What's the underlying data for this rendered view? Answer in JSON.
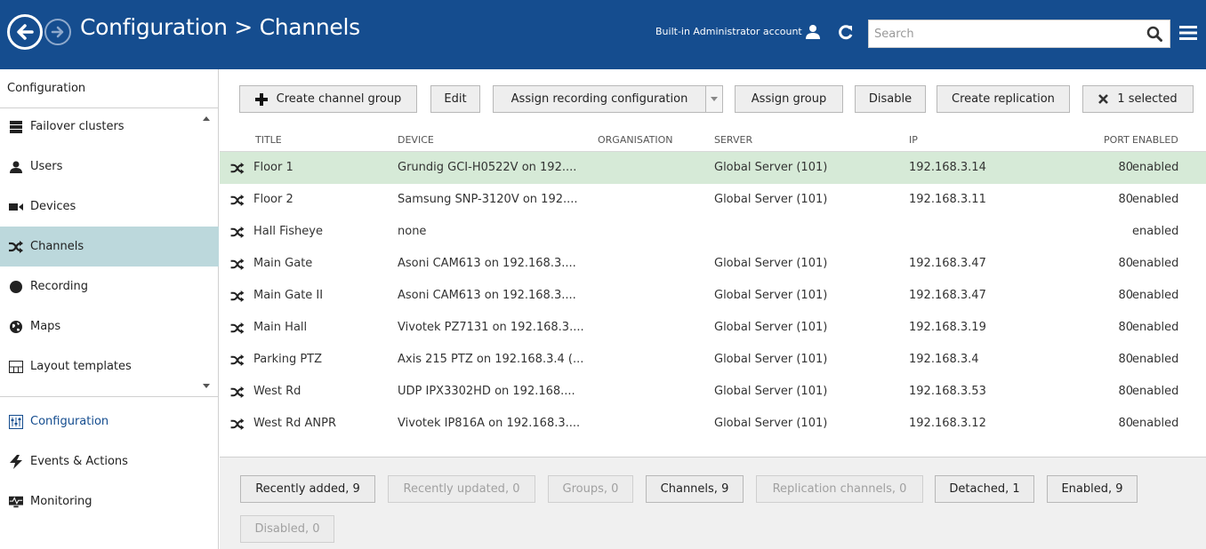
{
  "header": {
    "title": "Configuration > Channels",
    "account_label": "Built-in Administrator account",
    "search_placeholder": "Search"
  },
  "sidebar": {
    "heading": "Configuration",
    "items": [
      {
        "label": "Failover clusters",
        "icon": "server-icon"
      },
      {
        "label": "Users",
        "icon": "user-icon"
      },
      {
        "label": "Devices",
        "icon": "camera-icon"
      },
      {
        "label": "Channels",
        "icon": "shuffle-icon",
        "active": true
      },
      {
        "label": "Recording",
        "icon": "record-icon"
      },
      {
        "label": "Maps",
        "icon": "globe-icon"
      },
      {
        "label": "Layout templates",
        "icon": "layout-icon"
      }
    ],
    "bottom_items": [
      {
        "label": "Configuration",
        "icon": "sliders-icon"
      },
      {
        "label": "Events & Actions",
        "icon": "lightning-icon"
      },
      {
        "label": "Monitoring",
        "icon": "monitor-icon"
      }
    ]
  },
  "toolbar": {
    "create_group": "Create channel group",
    "edit": "Edit",
    "assign_recording": "Assign recording configuration",
    "assign_group": "Assign group",
    "disable": "Disable",
    "create_replication": "Create replication",
    "selected": "1 selected"
  },
  "table": {
    "columns": {
      "title": "TITLE",
      "device": "DEVICE",
      "organisation": "ORGANISATION",
      "server": "SERVER",
      "ip": "IP",
      "port": "PORT",
      "enabled": "ENABLED"
    },
    "rows": [
      {
        "title": "Floor 1",
        "device": "Grundig GCI-H0522V on 192....",
        "server": "Global Server (101)",
        "ip": "192.168.3.14",
        "port": "80",
        "enabled": "enabled"
      },
      {
        "title": "Floor 2",
        "device": "Samsung SNP-3120V on 192....",
        "server": "Global Server (101)",
        "ip": "192.168.3.11",
        "port": "80",
        "enabled": "enabled"
      },
      {
        "title": "Hall Fisheye",
        "device": "none",
        "server": "",
        "ip": "",
        "port": "",
        "enabled": "enabled"
      },
      {
        "title": "Main Gate",
        "device": "Asoni CAM613 on 192.168.3....",
        "server": "Global Server (101)",
        "ip": "192.168.3.47",
        "port": "80",
        "enabled": "enabled"
      },
      {
        "title": "Main Gate II",
        "device": "Asoni CAM613 on 192.168.3....",
        "server": "Global Server (101)",
        "ip": "192.168.3.47",
        "port": "80",
        "enabled": "enabled"
      },
      {
        "title": "Main Hall",
        "device": "Vivotek PZ7131 on 192.168.3....",
        "server": "Global Server (101)",
        "ip": "192.168.3.19",
        "port": "80",
        "enabled": "enabled"
      },
      {
        "title": "Parking PTZ",
        "device": "Axis 215 PTZ on 192.168.3.4 (...",
        "server": "Global Server (101)",
        "ip": "192.168.3.4",
        "port": "80",
        "enabled": "enabled"
      },
      {
        "title": "West Rd",
        "device": "UDP IPX3302HD on 192.168....",
        "server": "Global Server (101)",
        "ip": "192.168.3.53",
        "port": "80",
        "enabled": "enabled"
      },
      {
        "title": "West Rd ANPR",
        "device": "Vivotek IP816A on 192.168.3....",
        "server": "Global Server (101)",
        "ip": "192.168.3.12",
        "port": "80",
        "enabled": "enabled"
      }
    ]
  },
  "filters": {
    "recently_added": "Recently added, 9",
    "recently_updated": "Recently updated, 0",
    "groups": "Groups, 0",
    "channels": "Channels, 9",
    "replication": "Replication channels, 0",
    "detached": "Detached, 1",
    "enabled": "Enabled, 9",
    "disabled": "Disabled, 0"
  },
  "colors": {
    "header_bg": "#154d8f",
    "active_sidebar": "#bcd8dc",
    "selected_row": "#d6ead7"
  }
}
